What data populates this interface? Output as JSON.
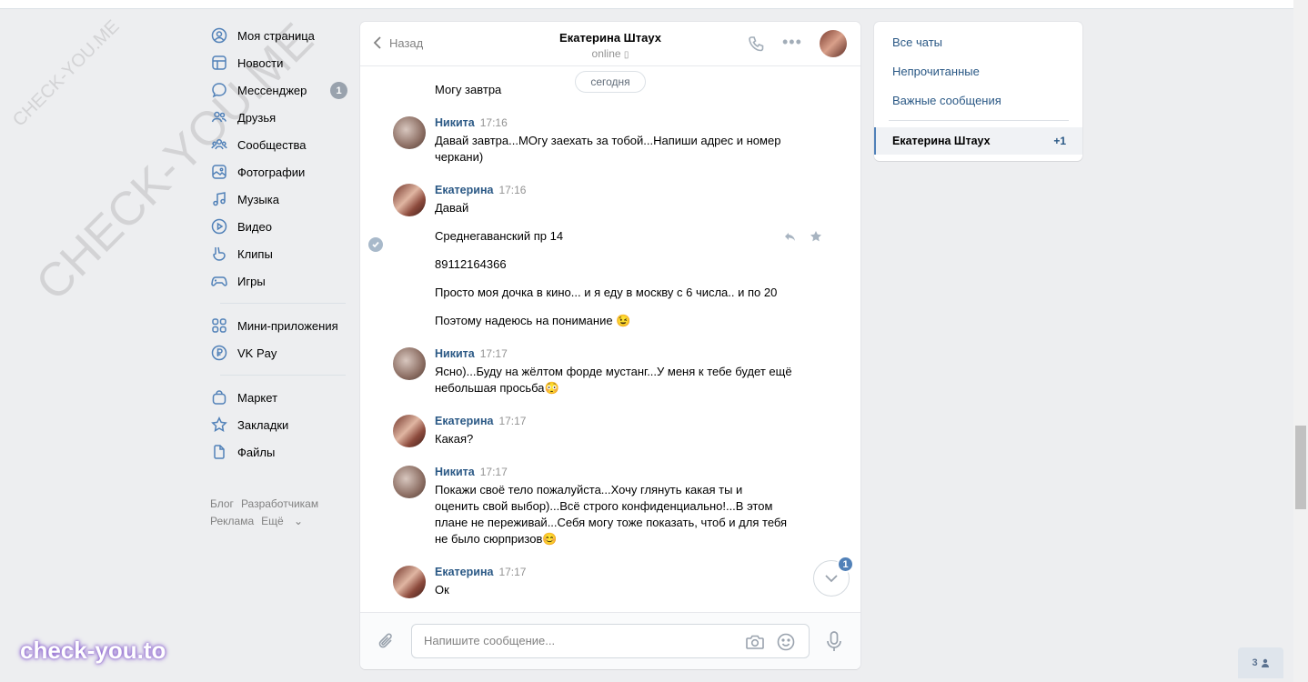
{
  "watermarks": {
    "small": "CHECK-YOU.ME",
    "large": "CHECK-YOU.ME"
  },
  "brand": "check-you.to",
  "nav": {
    "items": [
      {
        "label": "Моя страница",
        "icon": "user-circle-icon"
      },
      {
        "label": "Новости",
        "icon": "news-icon"
      },
      {
        "label": "Мессенджер",
        "icon": "message-bubble-icon",
        "badge": "1"
      },
      {
        "label": "Друзья",
        "icon": "friends-icon"
      },
      {
        "label": "Сообщества",
        "icon": "groups-icon"
      },
      {
        "label": "Фотографии",
        "icon": "photo-icon"
      },
      {
        "label": "Музыка",
        "icon": "music-note-icon"
      },
      {
        "label": "Видео",
        "icon": "play-icon"
      },
      {
        "label": "Клипы",
        "icon": "clips-icon"
      },
      {
        "label": "Игры",
        "icon": "gamepad-icon"
      }
    ],
    "items2": [
      {
        "label": "Мини-приложения",
        "icon": "apps-grid-icon"
      },
      {
        "label": "VK Pay",
        "icon": "ruble-icon"
      }
    ],
    "items3": [
      {
        "label": "Маркет",
        "icon": "bag-icon"
      },
      {
        "label": "Закладки",
        "icon": "star-icon"
      },
      {
        "label": "Файлы",
        "icon": "file-icon"
      }
    ],
    "footer": [
      "Блог",
      "Разработчикам",
      "Реклама",
      "Ещё"
    ]
  },
  "chat": {
    "back_label": "Назад",
    "title": "Екатерина Штаух",
    "status": "online",
    "date_pill": "сегодня",
    "partial_line": "Могу завтра",
    "messages": [
      {
        "author": "Никита",
        "time": "17:16",
        "lines": [
          "Давай завтра...МОгу заехать за тобой...Напиши адрес и номер черкани)"
        ]
      },
      {
        "author": "Екатерина",
        "time": "17:16",
        "lines": [
          "Давай",
          "Среднегаванский пр 14",
          "89112164366",
          "Просто моя дочка в кино... и я еду в москву с 6 числа.. и по 20",
          "Поэтому надеюсь на понимание 😉"
        ]
      },
      {
        "author": "Никита",
        "time": "17:17",
        "lines": [
          "Ясно)...Буду на жёлтом форде мустанг...У меня к тебе будет ещё небольшая просьба😳"
        ]
      },
      {
        "author": "Екатерина",
        "time": "17:17",
        "lines": [
          "Какая?"
        ]
      },
      {
        "author": "Никита",
        "time": "17:17",
        "lines": [
          "Покажи своё тело пожалуйста...Хочу глянуть какая ты и оценить свой выбор)...Всё строго конфиденциально!...В этом плане не переживай...Себя могу тоже показать, чтоб и для тебя не было сюрпризов😊"
        ]
      },
      {
        "author": "Екатерина",
        "time": "17:17",
        "lines": [
          "Ок"
        ]
      }
    ],
    "unread_badge": "1",
    "input_placeholder": "Напишите сообщение..."
  },
  "right": {
    "links": [
      "Все чаты",
      "Непрочитанные",
      "Важные сообщения"
    ],
    "active_chat": "Екатерина Штаух",
    "active_count": "+1"
  },
  "online_count": "3"
}
